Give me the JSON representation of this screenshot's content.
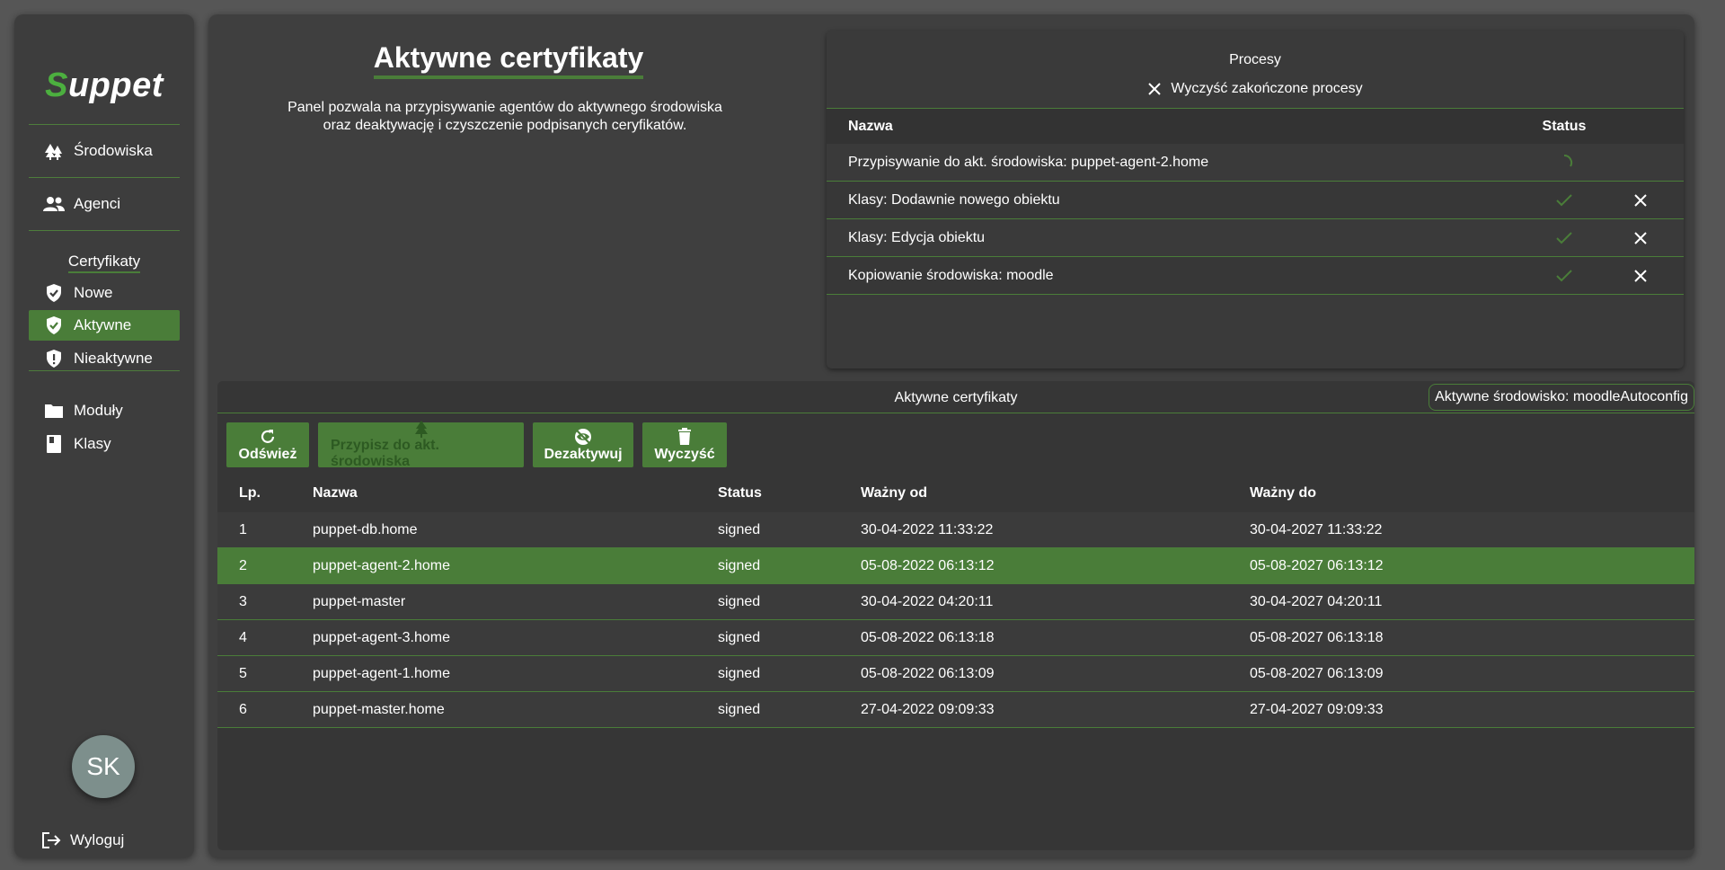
{
  "sidebar": {
    "logo_first": "S",
    "logo_rest": "uppet",
    "items": [
      {
        "label": "Środowiska",
        "icon": "trees-icon"
      },
      {
        "label": "Agenci",
        "icon": "people-icon"
      }
    ],
    "certificates_section": "Certyfikaty",
    "cert_items": [
      {
        "label": "Nowe",
        "icon": "shield-check-icon"
      },
      {
        "label": "Aktywne",
        "icon": "shield-check-icon",
        "active": true
      },
      {
        "label": "Nieaktywne",
        "icon": "shield-alert-icon"
      }
    ],
    "bottom_items": [
      {
        "label": "Moduły",
        "icon": "folder-icon"
      },
      {
        "label": "Klasy",
        "icon": "book-icon"
      }
    ],
    "avatar_initials": "SK",
    "logout_label": "Wyloguj"
  },
  "header": {
    "title": "Aktywne certyfikaty",
    "description_line1": "Panel pozwala na przypisywanie agentów do aktywnego środowiska",
    "description_line2": "oraz deaktywację i czyszczenie podpisanych ceryfikatów."
  },
  "processes": {
    "title": "Procesy",
    "clear_label": "Wyczyść zakończone procesy",
    "col_name": "Nazwa",
    "col_status": "Status",
    "rows": [
      {
        "name": "Przypisywanie do akt. środowiska: puppet-agent-2.home",
        "status": "running"
      },
      {
        "name": "Klasy: Dodawnie nowego obiektu",
        "status": "done"
      },
      {
        "name": "Klasy: Edycja obiektu",
        "status": "done"
      },
      {
        "name": "Kopiowanie środowiska: moodle",
        "status": "done"
      }
    ]
  },
  "certs": {
    "title": "Aktywne certyfikaty",
    "env_badge": "Aktywne środowisko: moodleAutoconfig",
    "toolbar": {
      "refresh": "Odśwież",
      "assign": "Przypisz do akt. środowiska",
      "deactivate": "Dezaktywuj",
      "clear": "Wyczyść"
    },
    "columns": {
      "lp": "Lp.",
      "name": "Nazwa",
      "status": "Status",
      "from": "Ważny od",
      "to": "Ważny do"
    },
    "rows": [
      {
        "lp": "1",
        "name": "puppet-db.home",
        "status": "signed",
        "from": "30-04-2022 11:33:22",
        "to": "30-04-2027 11:33:22"
      },
      {
        "lp": "2",
        "name": "puppet-agent-2.home",
        "status": "signed",
        "from": "05-08-2022 06:13:12",
        "to": "05-08-2027 06:13:12",
        "selected": true
      },
      {
        "lp": "3",
        "name": "puppet-master",
        "status": "signed",
        "from": "30-04-2022 04:20:11",
        "to": "30-04-2027 04:20:11"
      },
      {
        "lp": "4",
        "name": "puppet-agent-3.home",
        "status": "signed",
        "from": "05-08-2022 06:13:18",
        "to": "05-08-2027 06:13:18"
      },
      {
        "lp": "5",
        "name": "puppet-agent-1.home",
        "status": "signed",
        "from": "05-08-2022 06:13:09",
        "to": "05-08-2027 06:13:09"
      },
      {
        "lp": "6",
        "name": "puppet-master.home",
        "status": "signed",
        "from": "27-04-2022 09:09:33",
        "to": "27-04-2027 09:09:33"
      }
    ]
  },
  "colors": {
    "accent": "#4a7d39",
    "logo_green": "#4caf3f",
    "sidebar_bg": "#3d3d3d",
    "main_bg": "#3f3f3f"
  }
}
